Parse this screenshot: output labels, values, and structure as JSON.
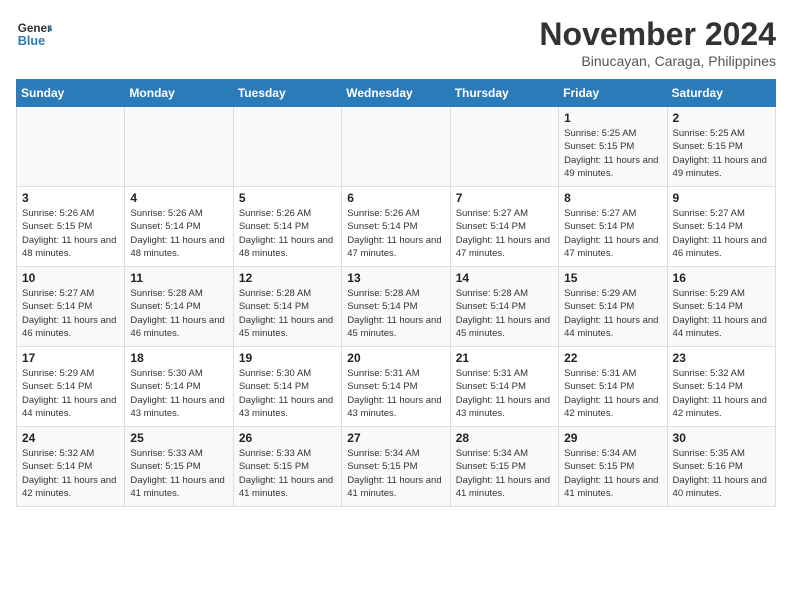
{
  "header": {
    "logo_line1": "General",
    "logo_line2": "Blue",
    "title": "November 2024",
    "subtitle": "Binucayan, Caraga, Philippines"
  },
  "days_of_week": [
    "Sunday",
    "Monday",
    "Tuesday",
    "Wednesday",
    "Thursday",
    "Friday",
    "Saturday"
  ],
  "weeks": [
    [
      {
        "day": "",
        "text": ""
      },
      {
        "day": "",
        "text": ""
      },
      {
        "day": "",
        "text": ""
      },
      {
        "day": "",
        "text": ""
      },
      {
        "day": "",
        "text": ""
      },
      {
        "day": "1",
        "text": "Sunrise: 5:25 AM\nSunset: 5:15 PM\nDaylight: 11 hours and 49 minutes."
      },
      {
        "day": "2",
        "text": "Sunrise: 5:25 AM\nSunset: 5:15 PM\nDaylight: 11 hours and 49 minutes."
      }
    ],
    [
      {
        "day": "3",
        "text": "Sunrise: 5:26 AM\nSunset: 5:15 PM\nDaylight: 11 hours and 48 minutes."
      },
      {
        "day": "4",
        "text": "Sunrise: 5:26 AM\nSunset: 5:14 PM\nDaylight: 11 hours and 48 minutes."
      },
      {
        "day": "5",
        "text": "Sunrise: 5:26 AM\nSunset: 5:14 PM\nDaylight: 11 hours and 48 minutes."
      },
      {
        "day": "6",
        "text": "Sunrise: 5:26 AM\nSunset: 5:14 PM\nDaylight: 11 hours and 47 minutes."
      },
      {
        "day": "7",
        "text": "Sunrise: 5:27 AM\nSunset: 5:14 PM\nDaylight: 11 hours and 47 minutes."
      },
      {
        "day": "8",
        "text": "Sunrise: 5:27 AM\nSunset: 5:14 PM\nDaylight: 11 hours and 47 minutes."
      },
      {
        "day": "9",
        "text": "Sunrise: 5:27 AM\nSunset: 5:14 PM\nDaylight: 11 hours and 46 minutes."
      }
    ],
    [
      {
        "day": "10",
        "text": "Sunrise: 5:27 AM\nSunset: 5:14 PM\nDaylight: 11 hours and 46 minutes."
      },
      {
        "day": "11",
        "text": "Sunrise: 5:28 AM\nSunset: 5:14 PM\nDaylight: 11 hours and 46 minutes."
      },
      {
        "day": "12",
        "text": "Sunrise: 5:28 AM\nSunset: 5:14 PM\nDaylight: 11 hours and 45 minutes."
      },
      {
        "day": "13",
        "text": "Sunrise: 5:28 AM\nSunset: 5:14 PM\nDaylight: 11 hours and 45 minutes."
      },
      {
        "day": "14",
        "text": "Sunrise: 5:28 AM\nSunset: 5:14 PM\nDaylight: 11 hours and 45 minutes."
      },
      {
        "day": "15",
        "text": "Sunrise: 5:29 AM\nSunset: 5:14 PM\nDaylight: 11 hours and 44 minutes."
      },
      {
        "day": "16",
        "text": "Sunrise: 5:29 AM\nSunset: 5:14 PM\nDaylight: 11 hours and 44 minutes."
      }
    ],
    [
      {
        "day": "17",
        "text": "Sunrise: 5:29 AM\nSunset: 5:14 PM\nDaylight: 11 hours and 44 minutes."
      },
      {
        "day": "18",
        "text": "Sunrise: 5:30 AM\nSunset: 5:14 PM\nDaylight: 11 hours and 43 minutes."
      },
      {
        "day": "19",
        "text": "Sunrise: 5:30 AM\nSunset: 5:14 PM\nDaylight: 11 hours and 43 minutes."
      },
      {
        "day": "20",
        "text": "Sunrise: 5:31 AM\nSunset: 5:14 PM\nDaylight: 11 hours and 43 minutes."
      },
      {
        "day": "21",
        "text": "Sunrise: 5:31 AM\nSunset: 5:14 PM\nDaylight: 11 hours and 43 minutes."
      },
      {
        "day": "22",
        "text": "Sunrise: 5:31 AM\nSunset: 5:14 PM\nDaylight: 11 hours and 42 minutes."
      },
      {
        "day": "23",
        "text": "Sunrise: 5:32 AM\nSunset: 5:14 PM\nDaylight: 11 hours and 42 minutes."
      }
    ],
    [
      {
        "day": "24",
        "text": "Sunrise: 5:32 AM\nSunset: 5:14 PM\nDaylight: 11 hours and 42 minutes."
      },
      {
        "day": "25",
        "text": "Sunrise: 5:33 AM\nSunset: 5:15 PM\nDaylight: 11 hours and 41 minutes."
      },
      {
        "day": "26",
        "text": "Sunrise: 5:33 AM\nSunset: 5:15 PM\nDaylight: 11 hours and 41 minutes."
      },
      {
        "day": "27",
        "text": "Sunrise: 5:34 AM\nSunset: 5:15 PM\nDaylight: 11 hours and 41 minutes."
      },
      {
        "day": "28",
        "text": "Sunrise: 5:34 AM\nSunset: 5:15 PM\nDaylight: 11 hours and 41 minutes."
      },
      {
        "day": "29",
        "text": "Sunrise: 5:34 AM\nSunset: 5:15 PM\nDaylight: 11 hours and 41 minutes."
      },
      {
        "day": "30",
        "text": "Sunrise: 5:35 AM\nSunset: 5:16 PM\nDaylight: 11 hours and 40 minutes."
      }
    ]
  ]
}
